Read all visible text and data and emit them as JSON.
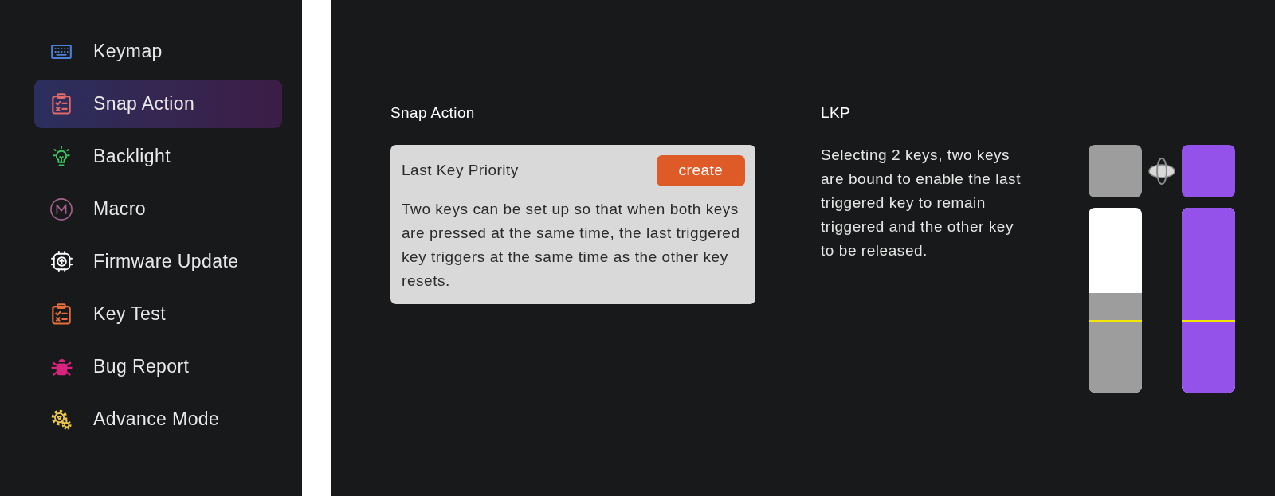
{
  "sidebar": {
    "items": [
      {
        "label": "Keymap",
        "selected": false
      },
      {
        "label": "Snap Action",
        "selected": true
      },
      {
        "label": "Backlight",
        "selected": false
      },
      {
        "label": "Macro",
        "selected": false
      },
      {
        "label": "Firmware Update",
        "selected": false
      },
      {
        "label": "Key Test",
        "selected": false
      },
      {
        "label": "Bug Report",
        "selected": false
      },
      {
        "label": "Advance Mode",
        "selected": false
      }
    ]
  },
  "snap_action": {
    "title": "Snap Action",
    "cards": [
      {
        "title": "Last Key Priority",
        "button": "create",
        "description": "Two keys can be set up so that when both keys are pressed at the same time, the last triggered key triggers at the same time as the other key resets."
      }
    ]
  },
  "lkp": {
    "title": "LKP",
    "description": "Selecting 2 keys, two keys are bound to enable the last triggered key to remain triggered and the other key to be released.",
    "keys": [
      {
        "triggered": false,
        "level": 0.54
      },
      {
        "triggered": true,
        "level": 1
      }
    ]
  }
}
